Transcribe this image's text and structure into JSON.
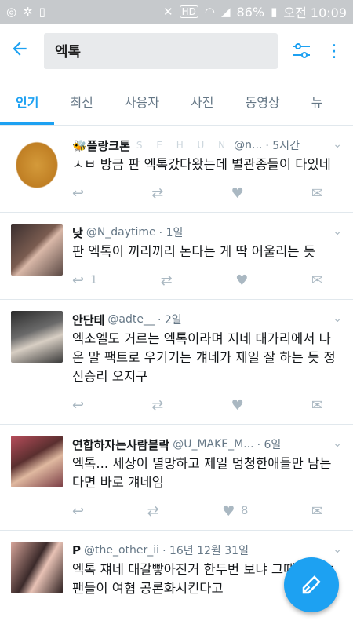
{
  "statusbar": {
    "battery": "86%",
    "time": "오전 10:09",
    "hd": "HD"
  },
  "search": {
    "query": "엑톡"
  },
  "tabs": [
    "인기",
    "최신",
    "사용자",
    "사진",
    "동영상",
    "뉴"
  ],
  "tweets": [
    {
      "name": "🐝플랑크톤",
      "handle_extra": "S E H U N",
      "handle": "@n...",
      "time": "· 5시간",
      "text": "ㅅㅂ 방금 판 엑톡갔다왔는데 별관종들이 다있네",
      "reply": "",
      "like": ""
    },
    {
      "name": "낮",
      "handle": "@N_daytime",
      "time": "· 1일",
      "text": "판 엑톡이 끼리끼리 논다는 게 딱 어울리는 듯",
      "reply": "1",
      "like": ""
    },
    {
      "name": "안단테",
      "handle": "@adte__",
      "time": "· 2일",
      "text": "엑소엘도 거르는 엑톡이라며 지네 대가리에서 나온 말 팩트로 우기기는 걔네가 제일 잘 하는 듯 정신승리 오지구",
      "reply": "",
      "like": ""
    },
    {
      "name": "연합하자는사람블락",
      "handle": "@U_MAKE_M...",
      "time": "· 6일",
      "text": "엑톡... 세상이 멸망하고 제일 멍청한애들만 남는다면 바로 걔네임",
      "reply": "",
      "like": "8"
    },
    {
      "name": "P",
      "handle": "@the_other_ii",
      "time": "· 16년 12월 31일",
      "text": "엑톡 쟤네 대갈빻아진거 한두번 보냐 그때도 ㅂㅌ팬들이 여혐 공론화시킨다고",
      "reply": "",
      "like": ""
    }
  ],
  "colors": {
    "accent": "#1da1f2",
    "statusbar": "#c6c9cc"
  }
}
